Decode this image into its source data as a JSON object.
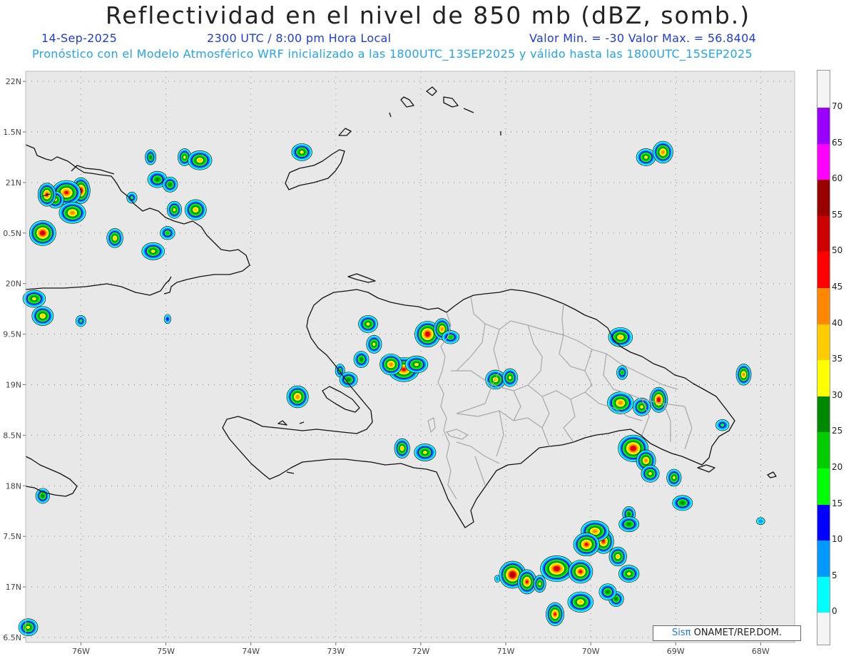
{
  "header": {
    "title": "Reflectividad en el nivel de 850 mb (dBZ, somb.)",
    "date": "14-Sep-2025",
    "time": "2300 UTC / 8:00 pm Hora Local",
    "range": "Valor Min. = -30  Valor Max. = 56.8404",
    "forecast_info": "Pronóstico con el Modelo Atmosférico WRF inicializado a las 1800UTC_13SEP2025 y válido hasta las  1800UTC_15SEP2025"
  },
  "map": {
    "lat_labels": [
      "22N",
      "1.5N",
      "21N",
      "0.5N",
      "20N",
      "9.5N",
      "19N",
      "8.5N",
      "18N",
      "7.5N",
      "17N",
      "6.5N"
    ],
    "lon_labels": [
      "76W",
      "75W",
      "74W",
      "73W",
      "72W",
      "71W",
      "70W",
      "69W",
      "68W"
    ],
    "extent": {
      "lon_min": -76.65,
      "lon_max": -67.6,
      "lat_min": 16.45,
      "lat_max": 22.1
    },
    "background_color": "#e8e8e8"
  },
  "credit": {
    "logo": "Sisπ",
    "text": " ONAMET/REP.DOM."
  },
  "colorbar": {
    "ticks": [
      "0",
      "5",
      "10",
      "15",
      "20",
      "25",
      "30",
      "35",
      "40",
      "45",
      "50",
      "55",
      "60",
      "65",
      "70"
    ],
    "colors": [
      "#00ffff",
      "#0099ff",
      "#0000ff",
      "#00ff00",
      "#00cc00",
      "#008800",
      "#ffff00",
      "#ffcc00",
      "#ff8800",
      "#ff0000",
      "#cc0000",
      "#990000",
      "#ff00ff",
      "#9900ff"
    ]
  },
  "cells": [
    {
      "lon": -76.0,
      "lat": 20.92,
      "dbz": 52
    },
    {
      "lon": -76.17,
      "lat": 20.9,
      "dbz": 48
    },
    {
      "lon": -76.3,
      "lat": 20.83,
      "dbz": 30
    },
    {
      "lon": -76.4,
      "lat": 20.88,
      "dbz": 45
    },
    {
      "lon": -76.1,
      "lat": 20.7,
      "dbz": 40
    },
    {
      "lon": -76.45,
      "lat": 20.5,
      "dbz": 50
    },
    {
      "lon": -75.6,
      "lat": 20.45,
      "dbz": 35
    },
    {
      "lon": -75.15,
      "lat": 20.32,
      "dbz": 30
    },
    {
      "lon": -74.98,
      "lat": 20.5,
      "dbz": 20
    },
    {
      "lon": -75.4,
      "lat": 20.85,
      "dbz": 15
    },
    {
      "lon": -75.18,
      "lat": 21.25,
      "dbz": 25
    },
    {
      "lon": -75.1,
      "lat": 21.03,
      "dbz": 28
    },
    {
      "lon": -74.95,
      "lat": 20.98,
      "dbz": 25
    },
    {
      "lon": -74.78,
      "lat": 21.25,
      "dbz": 30
    },
    {
      "lon": -74.6,
      "lat": 21.22,
      "dbz": 35
    },
    {
      "lon": -74.65,
      "lat": 20.73,
      "dbz": 38
    },
    {
      "lon": -74.9,
      "lat": 20.73,
      "dbz": 30
    },
    {
      "lon": -76.55,
      "lat": 19.85,
      "dbz": 30
    },
    {
      "lon": -76.45,
      "lat": 19.68,
      "dbz": 35
    },
    {
      "lon": -76.0,
      "lat": 19.63,
      "dbz": 15
    },
    {
      "lon": -74.98,
      "lat": 19.65,
      "dbz": 10
    },
    {
      "lon": -73.4,
      "lat": 21.3,
      "dbz": 30
    },
    {
      "lon": -71.92,
      "lat": 19.5,
      "dbz": 52
    },
    {
      "lon": -71.75,
      "lat": 19.55,
      "dbz": 40
    },
    {
      "lon": -72.2,
      "lat": 19.15,
      "dbz": 48
    },
    {
      "lon": -72.35,
      "lat": 19.2,
      "dbz": 40
    },
    {
      "lon": -72.55,
      "lat": 19.4,
      "dbz": 32
    },
    {
      "lon": -72.05,
      "lat": 19.2,
      "dbz": 30
    },
    {
      "lon": -72.62,
      "lat": 19.6,
      "dbz": 30
    },
    {
      "lon": -72.7,
      "lat": 19.25,
      "dbz": 28
    },
    {
      "lon": -72.95,
      "lat": 19.14,
      "dbz": 20
    },
    {
      "lon": -72.85,
      "lat": 19.05,
      "dbz": 25
    },
    {
      "lon": -73.45,
      "lat": 18.88,
      "dbz": 42
    },
    {
      "lon": -72.22,
      "lat": 18.37,
      "dbz": 36
    },
    {
      "lon": -71.95,
      "lat": 18.33,
      "dbz": 30
    },
    {
      "lon": -71.12,
      "lat": 19.05,
      "dbz": 35
    },
    {
      "lon": -70.95,
      "lat": 19.07,
      "dbz": 32
    },
    {
      "lon": -71.65,
      "lat": 19.47,
      "dbz": 20
    },
    {
      "lon": -69.5,
      "lat": 18.37,
      "dbz": 54
    },
    {
      "lon": -69.35,
      "lat": 18.25,
      "dbz": 40
    },
    {
      "lon": -69.2,
      "lat": 18.85,
      "dbz": 50
    },
    {
      "lon": -69.65,
      "lat": 18.82,
      "dbz": 42
    },
    {
      "lon": -69.4,
      "lat": 18.78,
      "dbz": 32
    },
    {
      "lon": -69.63,
      "lat": 19.12,
      "dbz": 22
    },
    {
      "lon": -69.65,
      "lat": 19.47,
      "dbz": 35
    },
    {
      "lon": -69.3,
      "lat": 18.12,
      "dbz": 30
    },
    {
      "lon": -69.02,
      "lat": 18.08,
      "dbz": 30
    },
    {
      "lon": -68.92,
      "lat": 17.83,
      "dbz": 25
    },
    {
      "lon": -69.35,
      "lat": 21.25,
      "dbz": 30
    },
    {
      "lon": -69.15,
      "lat": 21.3,
      "dbz": 42
    },
    {
      "lon": -68.2,
      "lat": 19.1,
      "dbz": 40
    },
    {
      "lon": -68.45,
      "lat": 18.6,
      "dbz": 15
    },
    {
      "lon": -70.92,
      "lat": 17.12,
      "dbz": 55
    },
    {
      "lon": -70.75,
      "lat": 17.05,
      "dbz": 48
    },
    {
      "lon": -70.4,
      "lat": 17.18,
      "dbz": 52
    },
    {
      "lon": -70.12,
      "lat": 17.15,
      "dbz": 45
    },
    {
      "lon": -69.85,
      "lat": 17.45,
      "dbz": 48
    },
    {
      "lon": -69.95,
      "lat": 17.55,
      "dbz": 40
    },
    {
      "lon": -70.05,
      "lat": 17.42,
      "dbz": 45
    },
    {
      "lon": -69.68,
      "lat": 17.3,
      "dbz": 35
    },
    {
      "lon": -70.6,
      "lat": 17.03,
      "dbz": 30
    },
    {
      "lon": -69.55,
      "lat": 17.13,
      "dbz": 30
    },
    {
      "lon": -69.7,
      "lat": 16.88,
      "dbz": 25
    },
    {
      "lon": -70.42,
      "lat": 16.73,
      "dbz": 45
    },
    {
      "lon": -70.12,
      "lat": 16.85,
      "dbz": 38
    },
    {
      "lon": -69.8,
      "lat": 16.95,
      "dbz": 28
    },
    {
      "lon": -69.55,
      "lat": 17.72,
      "dbz": 25
    },
    {
      "lon": -69.55,
      "lat": 17.62,
      "dbz": 25
    },
    {
      "lon": -76.62,
      "lat": 16.6,
      "dbz": 30
    },
    {
      "lon": -76.45,
      "lat": 17.9,
      "dbz": 25
    },
    {
      "lon": -71.1,
      "lat": 17.08,
      "dbz": 5
    },
    {
      "lon": -68.0,
      "lat": 17.65,
      "dbz": 5
    }
  ]
}
